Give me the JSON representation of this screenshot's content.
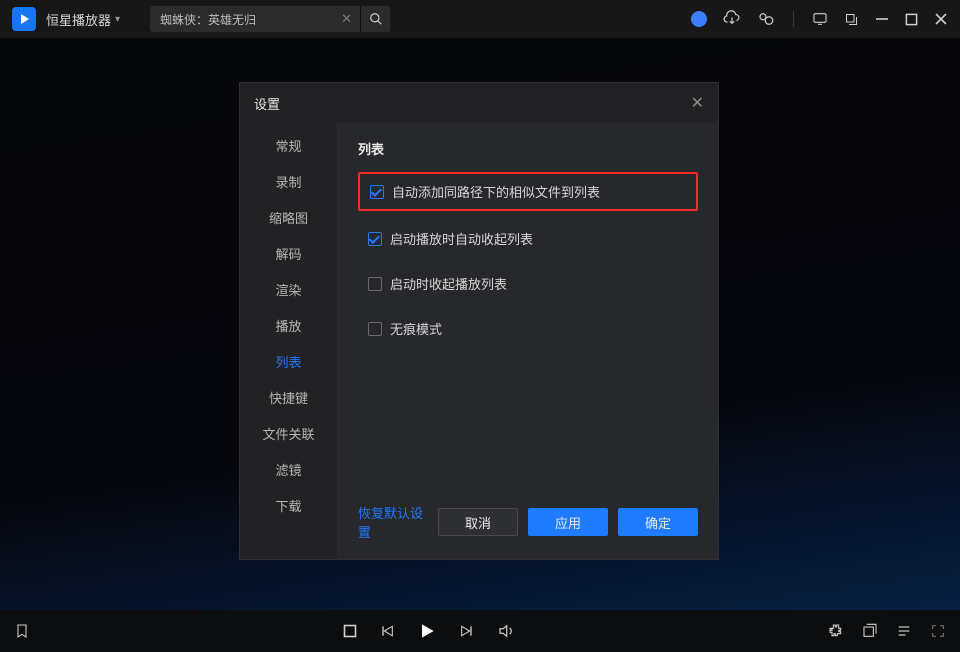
{
  "app": {
    "title": "恒星播放器"
  },
  "search": {
    "value": "蜘蛛侠：英雄无归"
  },
  "dialog": {
    "title": "设置",
    "nav": {
      "items": [
        "常规",
        "录制",
        "缩略图",
        "解码",
        "渲染",
        "播放",
        "列表",
        "快捷键",
        "文件关联",
        "滤镜",
        "下载"
      ],
      "active_index": 6
    },
    "section": {
      "title": "列表",
      "options": [
        {
          "label": "自动添加同路径下的相似文件到列表",
          "checked": true,
          "highlight": true
        },
        {
          "label": "启动播放时自动收起列表",
          "checked": true,
          "highlight": false
        },
        {
          "label": "启动时收起播放列表",
          "checked": false,
          "highlight": false
        },
        {
          "label": "无痕模式",
          "checked": false,
          "highlight": false
        }
      ]
    },
    "footer": {
      "restore": "恢复默认设置",
      "cancel": "取消",
      "apply": "应用",
      "ok": "确定"
    }
  }
}
